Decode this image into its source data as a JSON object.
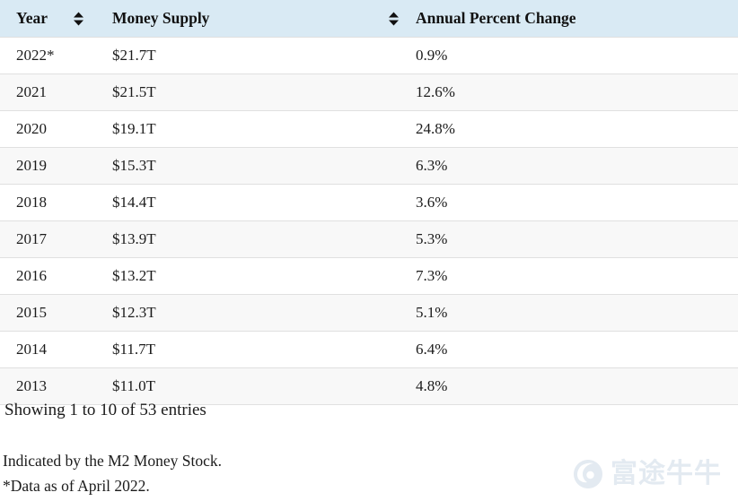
{
  "table": {
    "columns": [
      {
        "key": "year",
        "label": "Year",
        "sortable": true,
        "sort_state": "none"
      },
      {
        "key": "money",
        "label": "Money Supply",
        "sortable": true,
        "sort_state": "none"
      },
      {
        "key": "change",
        "label": "Annual Percent Change",
        "sortable": false,
        "sort_state": "none"
      }
    ],
    "sort_icon_name": "sort-both-icon",
    "rows": [
      {
        "year": "2022*",
        "money": "$21.7T",
        "change": "0.9%"
      },
      {
        "year": "2021",
        "money": "$21.5T",
        "change": "12.6%"
      },
      {
        "year": "2020",
        "money": "$19.1T",
        "change": "24.8%"
      },
      {
        "year": "2019",
        "money": "$15.3T",
        "change": "6.3%"
      },
      {
        "year": "2018",
        "money": "$14.4T",
        "change": "3.6%"
      },
      {
        "year": "2017",
        "money": "$13.9T",
        "change": "5.3%"
      },
      {
        "year": "2016",
        "money": "$13.2T",
        "change": "7.3%"
      },
      {
        "year": "2015",
        "money": "$12.3T",
        "change": "5.1%"
      },
      {
        "year": "2014",
        "money": "$11.7T",
        "change": "6.4%"
      },
      {
        "year": "2013",
        "money": "$11.0T",
        "change": "4.8%"
      }
    ]
  },
  "footer": {
    "showing": "Showing 1 to 10 of 53 entries",
    "note_1": "Indicated by the M2 Money Stock.",
    "note_2": "*Data as of April 2022."
  },
  "watermark": {
    "text": "富途牛牛",
    "logo_name": "futu-bull-logo-icon"
  },
  "colors": {
    "header_bg": "#d9eaf4",
    "row_even_bg": "#f8f8f8",
    "row_odd_bg": "#ffffff",
    "row_border": "#e0e0e0",
    "text": "#1b1b1b",
    "watermark": "#e3eaf1"
  },
  "chart_data": {
    "type": "table",
    "title": "U.S. Money Supply (M2) by Year",
    "columns": [
      "Year",
      "Money Supply",
      "Annual Percent Change"
    ],
    "x": [
      "2022*",
      "2021",
      "2020",
      "2019",
      "2018",
      "2017",
      "2016",
      "2015",
      "2014",
      "2013"
    ],
    "series": [
      {
        "name": "Money Supply (trillions USD)",
        "values": [
          21.7,
          21.5,
          19.1,
          15.3,
          14.4,
          13.9,
          13.2,
          12.3,
          11.7,
          11.0
        ]
      },
      {
        "name": "Annual Percent Change (%)",
        "values": [
          0.9,
          12.6,
          24.8,
          6.3,
          3.6,
          5.3,
          7.3,
          5.1,
          6.4,
          4.8
        ]
      }
    ],
    "xlabel": "Year",
    "ylabel": "",
    "notes": [
      "Indicated by the M2 Money Stock.",
      "*Data as of April 2022."
    ],
    "total_entries": 53,
    "shown_entries": 10
  }
}
